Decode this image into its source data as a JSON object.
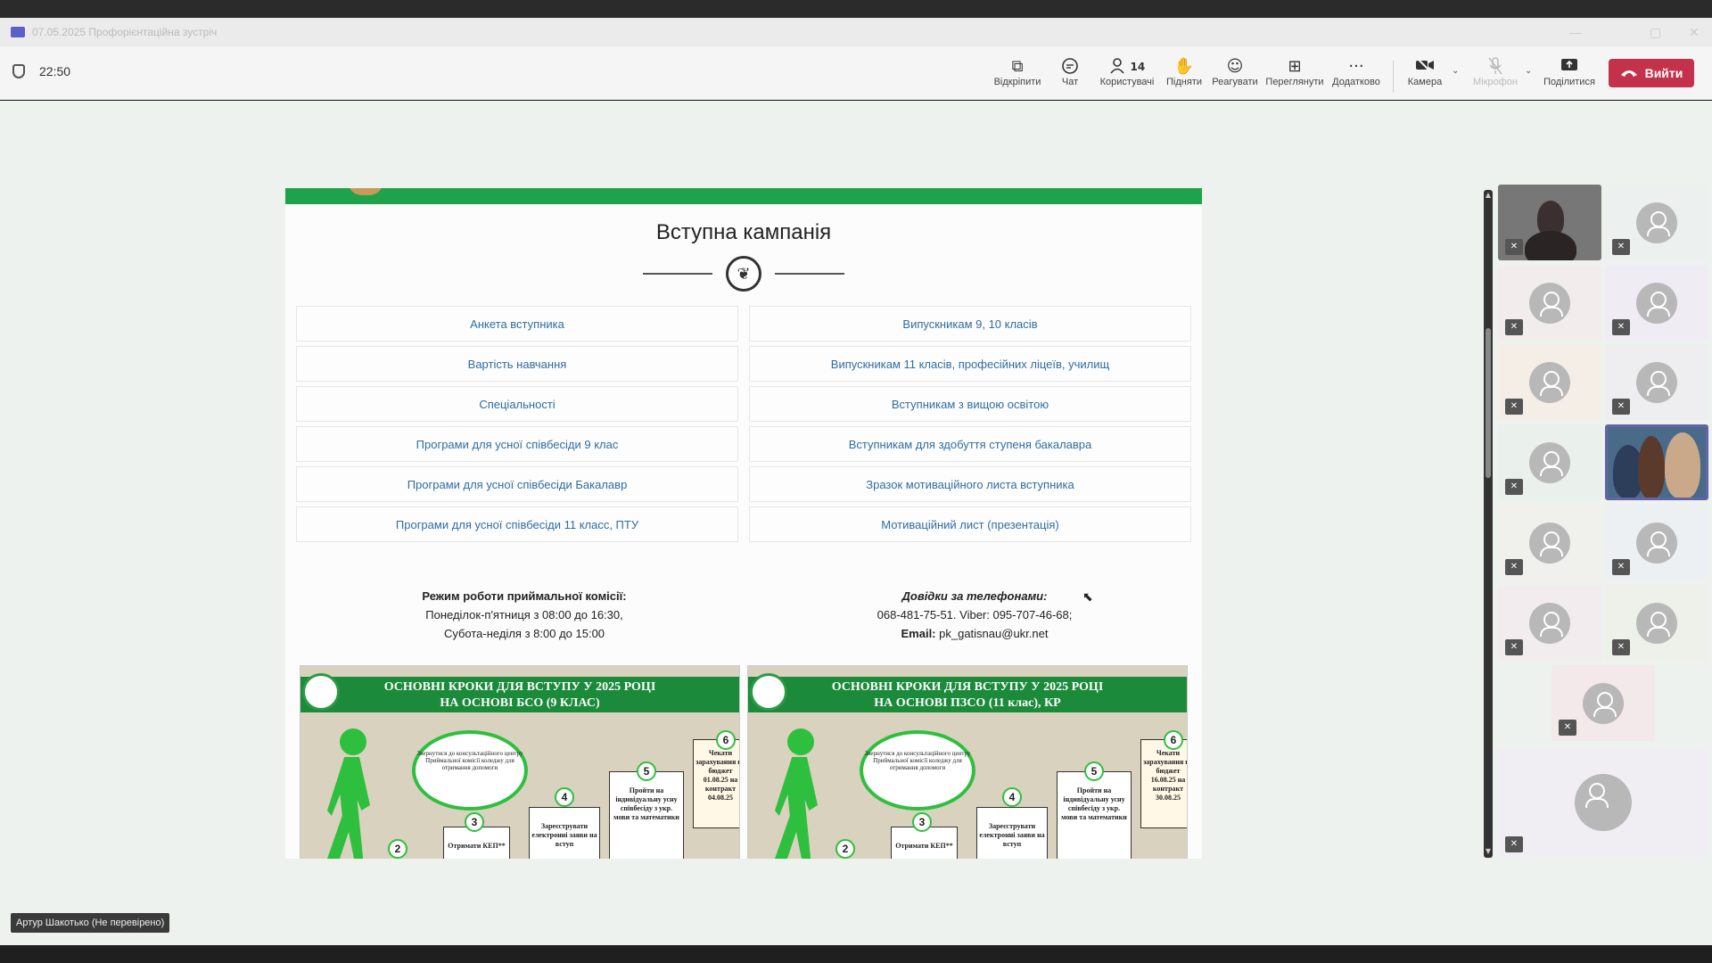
{
  "titlebar": {
    "title": "07.05.2025 Профорієнтаційна зустріч",
    "controls": [
      "—",
      "▢",
      "✕"
    ]
  },
  "toolbar": {
    "timer": "22:50",
    "buttons": [
      {
        "name": "open-button",
        "label": "Відкріпити",
        "icon": "pop-out-icon",
        "glyph": "⧉"
      },
      {
        "name": "chat-button",
        "label": "Чат",
        "icon": "chat-icon",
        "glyph": "💬"
      },
      {
        "name": "people-button",
        "label": "Користувачі",
        "icon": "people-icon",
        "glyph": "👤",
        "count": "14"
      },
      {
        "name": "raise-hand-button",
        "label": "Підняти",
        "icon": "hand-icon",
        "glyph": "✋"
      },
      {
        "name": "react-button",
        "label": "Реагувати",
        "icon": "smile-icon",
        "glyph": "☺"
      },
      {
        "name": "view-button",
        "label": "Переглянути",
        "icon": "grid-icon",
        "glyph": "⊞"
      },
      {
        "name": "more-button",
        "label": "Додатково",
        "icon": "more-icon",
        "glyph": "···"
      }
    ],
    "camera_label": "Камера",
    "mic_label": "Мікрофон",
    "share_label": "Поділитися",
    "leave_label": "Вийти"
  },
  "shared_page": {
    "title": "Вступна кампанія",
    "links_left": [
      "Анкета вступника",
      "Вартість навчання",
      "Спеціальності",
      "Програми для усної співбесіди 9 клас",
      "Програми для усної співбесіди Бакалавр",
      "Програми для усної співбесіди 11 класс, ПТУ"
    ],
    "links_right": [
      "Випускникам 9, 10 класів",
      "Випускникам 11 класів, професійних ліцеїв, училищ",
      "Вступникам з вищою освітою",
      "Вступникам для здобуття ступеня бакалавра",
      "Зразок мотиваційного листа вступника",
      "Мотиваційний лист (презентація)"
    ],
    "office_hours": {
      "heading": "Режим роботи приймальної комісії:",
      "weekdays": "Понеділок-п'ятниця з 08:00 до 16:30,",
      "weekend": "Субота-неділя з 8:00 до 15:00"
    },
    "contacts": {
      "heading": "Довідки за телефонами:",
      "phones": "068-481-75-51. Viber: 095-707-46-68;",
      "email_label": "Email:",
      "email": "pk_gatisnau@ukr.net"
    },
    "posters": [
      {
        "title_line1": "ОСНОВНІ КРОКИ ДЛЯ ВСТУПУ У 2025 РОЦІ",
        "title_line2": "НА ОСНОВІ БСО (9 КЛАС)",
        "oval_text": "Звернутися до консультаційного центру Приймальної комісії коледжу для отримання допомоги",
        "step3": "Отримати КЕП**",
        "step4": "Зареєструвати електронні заяви на вступ",
        "step5": "Пройти на індивідуальну усну співбесіду з укр. мови та математики",
        "step6": "Чекати зарахування на бюджет 01.08.25 на контракт 04.08.25"
      },
      {
        "title_line1": "ОСНОВНІ КРОКИ ДЛЯ ВСТУПУ У 2025 РОЦІ",
        "title_line2": "НА ОСНОВІ ПЗСО (11 клас), КР",
        "oval_text": "Звернутися до консультаційного центру Приймальної комісії коледжу для отримання допомоги",
        "step3": "Отримати КЕП**",
        "step4": "Зареєструвати електронні заяви на вступ",
        "step5": "Пройти на індивідуальну усну співбесіду з укр. мови та математики",
        "step6": "Чекати зарахування на бюджет 16.08.25 на контракт 30.08.25"
      }
    ]
  },
  "presenter_tag": "Артур Шакотько (Не перевірено)",
  "colors": {
    "leave": "#c4314b",
    "site_green": "#1fa34a",
    "link": "#2f6da3",
    "teams_purple": "#6264a7"
  }
}
